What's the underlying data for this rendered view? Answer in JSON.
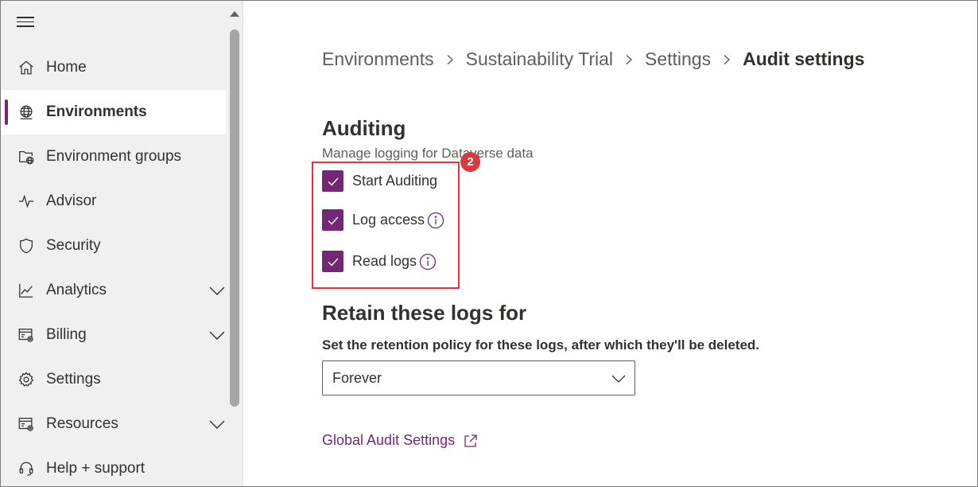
{
  "sidebar": {
    "items": [
      {
        "label": "Home",
        "icon": "home-icon",
        "active": false,
        "expandable": false
      },
      {
        "label": "Environments",
        "icon": "globe-icon",
        "active": true,
        "expandable": false
      },
      {
        "label": "Environment groups",
        "icon": "folder-globe-icon",
        "active": false,
        "expandable": false
      },
      {
        "label": "Advisor",
        "icon": "pulse-icon",
        "active": false,
        "expandable": false
      },
      {
        "label": "Security",
        "icon": "shield-icon",
        "active": false,
        "expandable": false
      },
      {
        "label": "Analytics",
        "icon": "chart-line-icon",
        "active": false,
        "expandable": true
      },
      {
        "label": "Billing",
        "icon": "billing-icon",
        "active": false,
        "expandable": true
      },
      {
        "label": "Settings",
        "icon": "gear-icon",
        "active": false,
        "expandable": false
      },
      {
        "label": "Resources",
        "icon": "resources-icon",
        "active": false,
        "expandable": true
      },
      {
        "label": "Help + support",
        "icon": "headset-icon",
        "active": false,
        "expandable": false
      }
    ]
  },
  "breadcrumb": {
    "items": [
      "Environments",
      "Sustainability Trial",
      "Settings"
    ],
    "current": "Audit settings"
  },
  "auditing": {
    "title": "Auditing",
    "subtitle": "Manage logging for Dataverse data",
    "checkboxes": [
      {
        "label": "Start Auditing",
        "checked": true,
        "info": false
      },
      {
        "label": "Log access",
        "checked": true,
        "info": true
      },
      {
        "label": "Read logs",
        "checked": true,
        "info": true
      }
    ],
    "callout_number": "2"
  },
  "retention": {
    "title": "Retain these logs for",
    "subtitle": "Set the retention policy for these logs, after which they'll be deleted.",
    "selected": "Forever"
  },
  "global_link": {
    "label": "Global Audit Settings"
  },
  "colors": {
    "accent": "#742774",
    "highlight": "#e8313f",
    "sidebar_bg": "#f0f0f0"
  }
}
